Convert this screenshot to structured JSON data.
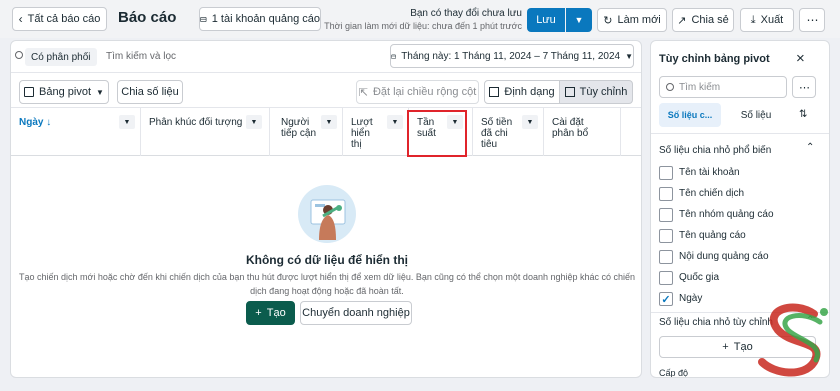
{
  "topbar": {
    "back_label": "Tất cả báo cáo",
    "title": "Báo cáo",
    "account_label": "1 tài khoản quảng cáo",
    "unsaved_title": "Bạn có thay đổi chưa lưu",
    "unsaved_sub": "Thời gian làm mới dữ liệu: chưa đến 1 phút trước",
    "save_label": "Lưu",
    "refresh_label": "Làm mới",
    "share_label": "Chia sẻ",
    "export_label": "Xuất"
  },
  "filters": {
    "chip_label": "Có phân phối",
    "search_placeholder": "Tìm kiếm và lọc",
    "date_range": "Tháng này: 1 Tháng 11, 2024 – 7 Tháng 11, 2024"
  },
  "toolbar": {
    "pivot_label": "Bảng pivot",
    "breakdown_label": "Chia số liệu",
    "reset_width_label": "Đặt lại chiều rộng cột",
    "format_label": "Định dạng",
    "customize_label": "Tùy chỉnh"
  },
  "columns": [
    {
      "label": "Ngày ↓"
    },
    {
      "label": "Phân khúc đối tượng"
    },
    {
      "label": "Người\ntiếp cận"
    },
    {
      "label": "Lượt\nhiển\nthị"
    },
    {
      "label": "Tần\nsuất"
    },
    {
      "label": "Số tiền\nđã chi\ntiêu"
    },
    {
      "label": "Cài đặt\nphân bổ"
    }
  ],
  "empty": {
    "title": "Không có dữ liệu để hiển thị",
    "description": "Tạo chiến dịch mới hoặc chờ đến khi chiến dịch của bạn thu hút được lượt hiển thị để xem dữ liệu. Bạn cũng có thể chọn một doanh nghiệp khác có chiến dịch đang hoạt động hoặc đã hoàn tất.",
    "create_label": "Tạo",
    "switch_label": "Chuyển doanh nghiệp"
  },
  "panel": {
    "title": "Tùy chỉnh bảng pivot",
    "search_placeholder": "Tìm kiếm",
    "tab_breakdown": "Số liệu c...",
    "tab_metrics": "Số liệu",
    "section_common": "Số liệu chia nhỏ phổ biến",
    "items": [
      {
        "label": "Tên tài khoản",
        "checked": false
      },
      {
        "label": "Tên chiến dịch",
        "checked": false
      },
      {
        "label": "Tên nhóm quảng cáo",
        "checked": false
      },
      {
        "label": "Tên quảng cáo",
        "checked": false
      },
      {
        "label": "Nội dung quảng cáo",
        "checked": false
      },
      {
        "label": "Quốc gia",
        "checked": false
      },
      {
        "label": "Ngày",
        "checked": true
      }
    ],
    "section_custom": "Số liệu chia nhỏ tùy chỉnh",
    "create_label": "Tạo",
    "cut_label": "Cấp độ"
  },
  "colors": {
    "primary": "#0a78be",
    "create_green": "#0b5c4d",
    "highlight_red": "#e0242b"
  }
}
